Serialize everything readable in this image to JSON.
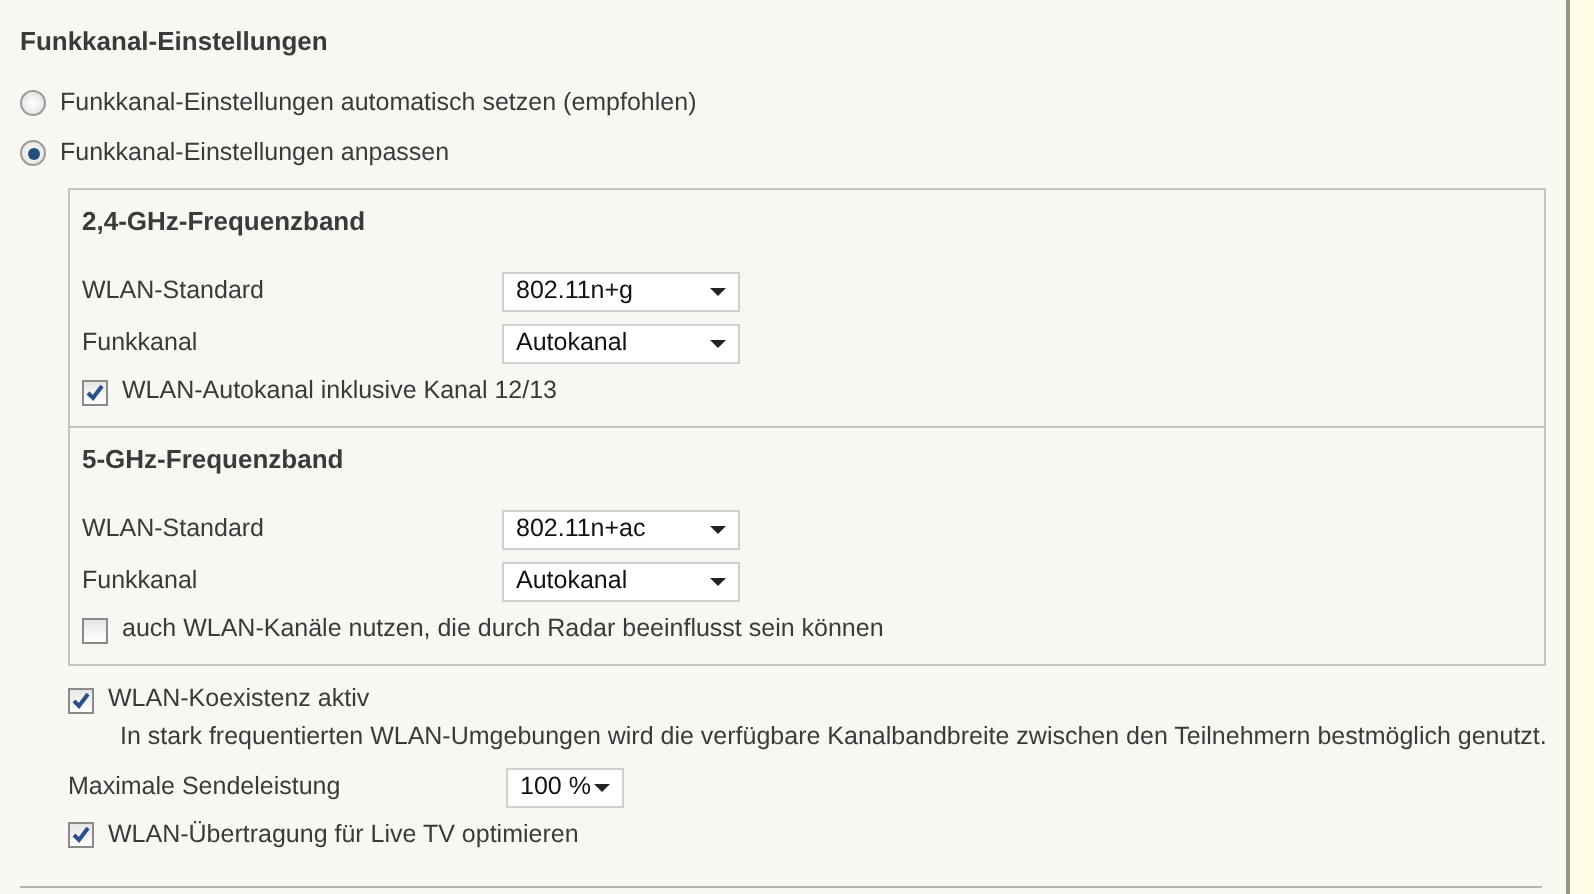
{
  "section_title": "Funkkanal-Einstellungen",
  "mode_options": [
    {
      "label": "Funkkanal-Einstellungen automatisch setzen (empfohlen)",
      "selected": false
    },
    {
      "label": "Funkkanal-Einstellungen anpassen",
      "selected": true
    }
  ],
  "bands": [
    {
      "title": "2,4-GHz-Frequenzband",
      "settings": [
        {
          "label": "WLAN-Standard",
          "value": "802.11n+g"
        },
        {
          "label": "Funkkanal",
          "value": "Autokanal"
        }
      ],
      "option": {
        "label": "WLAN-Autokanal inklusive Kanal 12/13",
        "checked": true
      }
    },
    {
      "title": "5-GHz-Frequenzband",
      "settings": [
        {
          "label": "WLAN-Standard",
          "value": "802.11n+ac"
        },
        {
          "label": "Funkkanal",
          "value": "Autokanal"
        }
      ],
      "option": {
        "label": "auch WLAN-Kanäle nutzen, die durch Radar beeinflusst sein können",
        "checked": false
      }
    }
  ],
  "options": [
    {
      "kind": "checkbox",
      "label": "WLAN-Koexistenz aktiv",
      "checked": true,
      "description": "In stark frequentierten WLAN-Umgebungen wird die verfügbare Kanalbandbreite zwischen den Teilnehmern bestmöglich genutzt."
    },
    {
      "kind": "select",
      "label": "Maximale Sendeleistung",
      "value": "100 %"
    },
    {
      "kind": "checkbox",
      "label": "WLAN-Übertragung für Live TV optimieren",
      "checked": true
    }
  ]
}
